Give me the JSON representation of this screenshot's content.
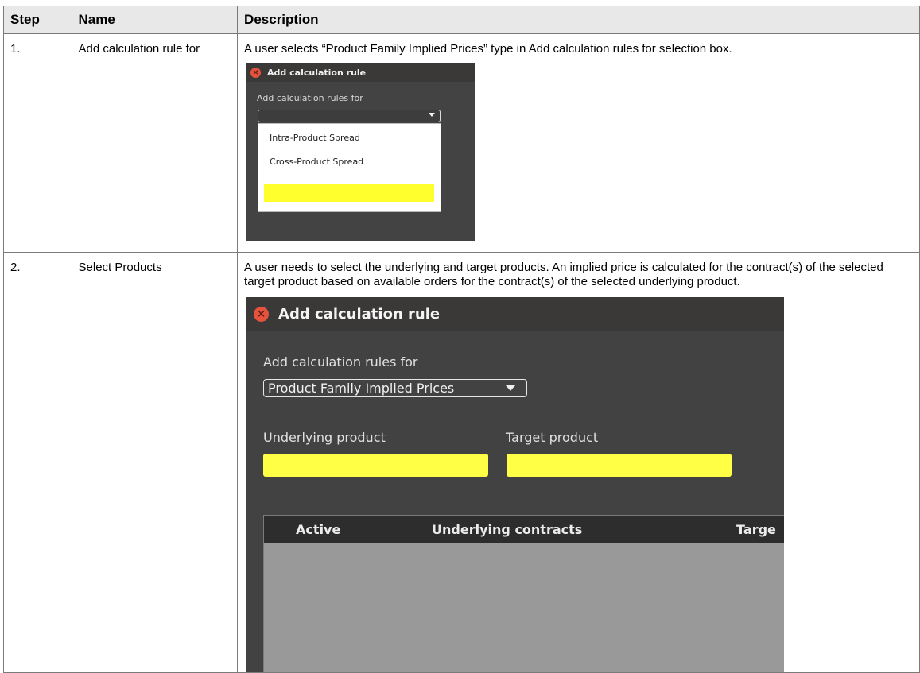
{
  "table": {
    "headers": [
      "Step",
      "Name",
      "Description"
    ],
    "rows": [
      {
        "step": "1.",
        "name": "Add calculation rule for",
        "description": "A user selects “Product Family Implied Prices” type in Add calculation rules for selection box."
      },
      {
        "step": "2.",
        "name": "Select Products",
        "description": "A user needs to select the underlying and target products. An implied price is calculated for the contract(s) of the selected target product based on available orders for the contract(s) of the selected underlying product."
      }
    ]
  },
  "dialog_small": {
    "title": "Add calculation rule",
    "label": "Add calculation rules for",
    "combo_value": "",
    "options": [
      "Intra-Product Spread",
      "Cross-Product Spread"
    ]
  },
  "dialog_large": {
    "title": "Add calculation rule",
    "label": "Add calculation rules for",
    "combo_value": "Product Family Implied Prices",
    "underlying_label": "Underlying product",
    "target_label": "Target product",
    "columns": [
      "Active",
      "Underlying contracts",
      "Targe"
    ]
  },
  "colors": {
    "highlight": "#ffff46",
    "dialog_bg": "#424242",
    "close_button": "#e5533f"
  }
}
